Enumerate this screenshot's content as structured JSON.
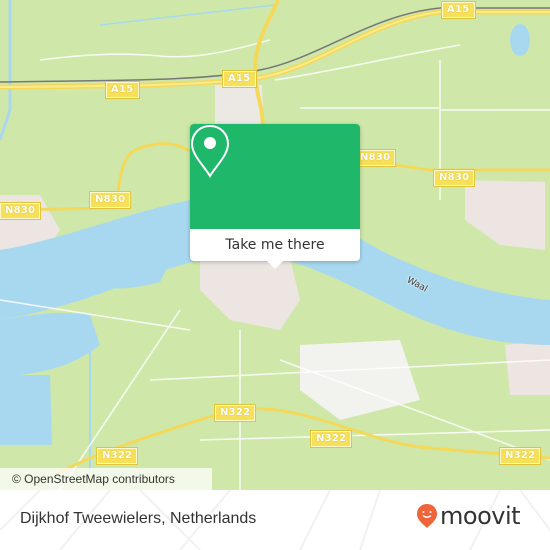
{
  "map": {
    "attribution": "© OpenStreetMap contributors",
    "road_labels": [
      {
        "id": "a15-west",
        "text": "A15"
      },
      {
        "id": "a15-center",
        "text": "A15"
      },
      {
        "id": "a15-east",
        "text": "A15"
      },
      {
        "id": "n830-west",
        "text": "N830"
      },
      {
        "id": "n830-center",
        "text": "N830"
      },
      {
        "id": "n830-east-1",
        "text": "N830"
      },
      {
        "id": "n830-east-2",
        "text": "N830"
      },
      {
        "id": "n322-west",
        "text": "N322"
      },
      {
        "id": "n322-center",
        "text": "N322"
      },
      {
        "id": "n322-mid",
        "text": "N322"
      },
      {
        "id": "n322-east",
        "text": "N322"
      }
    ],
    "water_labels": [
      {
        "text": "Waal"
      }
    ],
    "colors": {
      "land": "#cfe8a9",
      "water": "#a8d8f0",
      "urban": "#ece5e1",
      "motorway": "#f6e05a",
      "rail": "#777777"
    }
  },
  "popup": {
    "icon": "location-pin-icon",
    "cta_label": "Take me there",
    "accent_color": "#1fb86a"
  },
  "footer": {
    "place_name": "Dijkhof Tweewielers, Netherlands",
    "brand": {
      "name": "moovit",
      "icon": "moovit-smile-pin-icon",
      "color": "#f0643a"
    }
  }
}
